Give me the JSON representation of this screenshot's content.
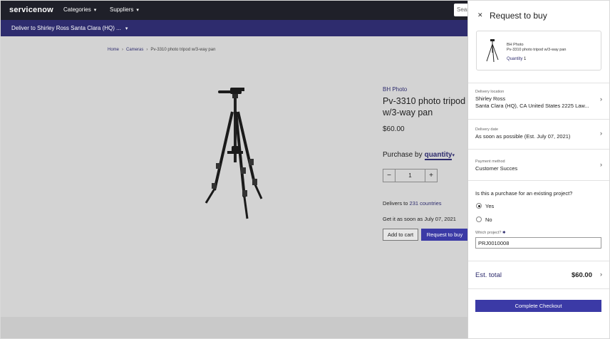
{
  "nav": {
    "logo": "servicenow",
    "categories": "Categories",
    "suppliers": "Suppliers",
    "search_placeholder": "Sear"
  },
  "subnav": {
    "deliver_to": "Deliver to Shirley Ross Santa Clara (HQ) ..."
  },
  "breadcrumb": {
    "home": "Home",
    "cameras": "Cameras",
    "current": "Pv-3310 photo tripod w/3-way pan"
  },
  "product": {
    "brand": "BH Photo",
    "title": "Pv-3310 photo tripod w/3-way pan",
    "price": "$60.00",
    "purchase_by_label": "Purchase by",
    "purchase_by_value": "quantity",
    "quantity": "1",
    "delivers_to_prefix": "Delivers to",
    "delivers_to_link": "231 countries",
    "get_it": "Get it as soon as July 07, 2021",
    "add_to_cart": "Add to cart",
    "request_to_buy": "Request to buy"
  },
  "panel": {
    "title": "Request to buy",
    "item": {
      "brand": "BH Photo",
      "name": "Pv-3310 photo tripod w/3-way pan",
      "qty_label": "Quantity",
      "qty_value": "1"
    },
    "delivery_location": {
      "label": "Delivery location",
      "name": "Shirley Ross",
      "address": "Santa Clara (HQ), CA United States 2225 Law..."
    },
    "delivery_date": {
      "label": "Delivery date",
      "value": "As soon as possible (Est. July 07, 2021)"
    },
    "payment_method": {
      "label": "Payment method",
      "value": "Customer Succes"
    },
    "question": "Is this a purchase for an existing project?",
    "options": [
      "Yes",
      "No"
    ],
    "selected_option": "Yes",
    "project_label": "Which project?",
    "project_required_mark": "✱",
    "project_value": "PRJ0010008",
    "est_total_label": "Est. total",
    "est_total_value": "$60.00",
    "complete_checkout": "Complete Checkout"
  },
  "colors": {
    "topbar": "#1f2029",
    "subbar": "#2e2c6e",
    "primary_button": "#3b3aa6",
    "link": "#2e2c6e",
    "page_background": "#d3d3d3"
  }
}
